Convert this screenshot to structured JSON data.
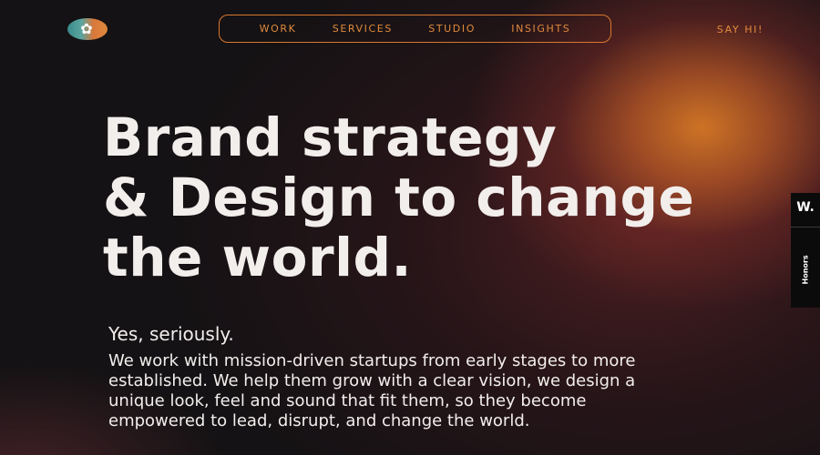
{
  "nav": {
    "items": [
      {
        "label": "WORK"
      },
      {
        "label": "SERVICES"
      },
      {
        "label": "STUDIO"
      },
      {
        "label": "INSIGHTS"
      }
    ],
    "cta": "SAY HI!"
  },
  "hero": {
    "headline_lines": [
      "Brand strategy",
      "& Design to change",
      "the world."
    ],
    "tagline": "Yes, seriously.",
    "body_lines": [
      "We work with mission-driven startups from early stages to more",
      "established. We help them grow with a clear vision, we design a",
      "unique look, feel and sound that fit them, so they become",
      "empowered to lead, disrupt, and change the world."
    ]
  },
  "honors_tab": {
    "mark": "W.",
    "label": "Honors"
  },
  "icons": {
    "logo": "flower-logo-icon"
  },
  "colors": {
    "accent": "#e08a3c",
    "background": "#141214",
    "text": "#f2eeec"
  }
}
